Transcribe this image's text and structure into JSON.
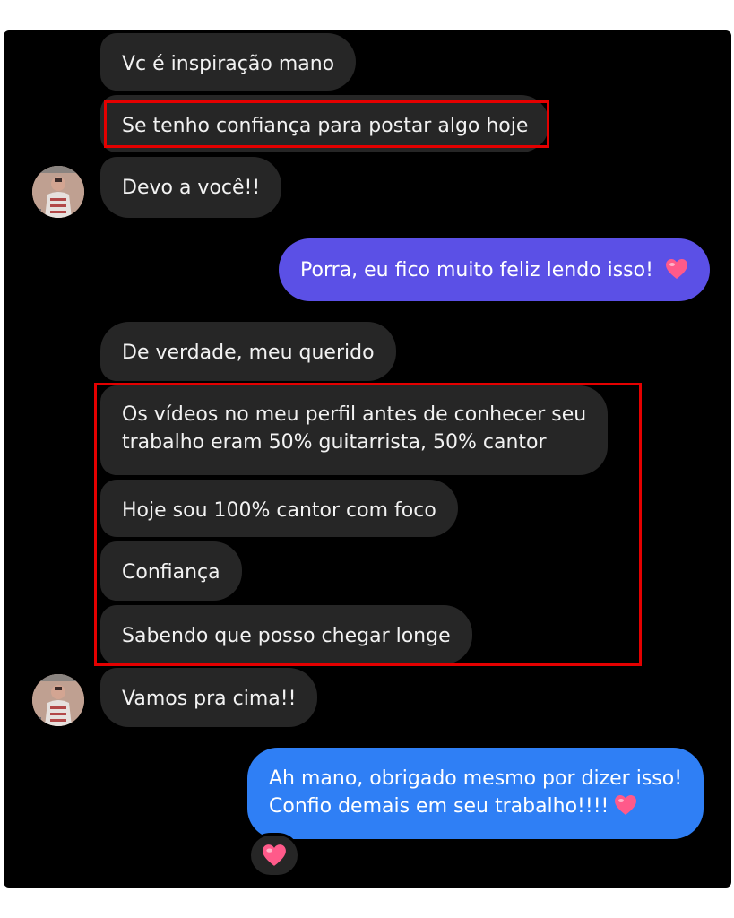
{
  "conversation": {
    "messages": [
      {
        "sender": "them",
        "text": "Vc é inspiração mano"
      },
      {
        "sender": "them",
        "text": "Se tenho confiança para postar algo hoje",
        "highlighted": true
      },
      {
        "sender": "them",
        "text": "Devo a você!!"
      },
      {
        "sender": "me",
        "text": "Porra, eu fico muito feliz lendo isso!",
        "emoji": "heart"
      },
      {
        "sender": "them",
        "text": "De verdade, meu querido"
      },
      {
        "sender": "them",
        "lines": [
          "Os vídeos no meu perfil antes de conhecer seu",
          "trabalho eram 50% guitarrista, 50% cantor"
        ],
        "highlighted": true
      },
      {
        "sender": "them",
        "text": "Hoje sou 100% cantor com foco",
        "highlighted": true
      },
      {
        "sender": "them",
        "text": "Confiança",
        "highlighted": true
      },
      {
        "sender": "them",
        "text": "Sabendo que posso chegar longe",
        "highlighted": true
      },
      {
        "sender": "them",
        "text": "Vamos pra cima!!"
      },
      {
        "sender": "me",
        "lines": [
          "Ah mano, obrigado mesmo por dizer isso!",
          "Confio demais em seu trabalho!!!!"
        ],
        "emoji": "heart",
        "reaction": "heart"
      }
    ]
  },
  "colors": {
    "background": "#000000",
    "incoming_bubble": "#262626",
    "outgoing_bubble_purple": "#5b50e6",
    "outgoing_bubble_blue": "#2f7ff5",
    "highlight_box": "#e40000",
    "heart": "#ff5a8a"
  },
  "icons": {
    "heart": "heart-emoji",
    "avatar": "contact-avatar"
  }
}
